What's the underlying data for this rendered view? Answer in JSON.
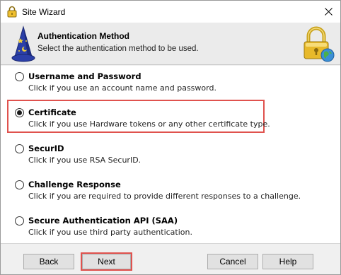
{
  "window": {
    "title": "Site Wizard",
    "close_symbol": "✕"
  },
  "header": {
    "title": "Authentication Method",
    "subtitle": "Select the authentication method to be used."
  },
  "options": [
    {
      "label": "Username and Password",
      "description": "Click if you use an account name and password.",
      "selected": false
    },
    {
      "label": "Certificate",
      "description": "Click if you use Hardware tokens or any other certificate type.",
      "selected": true
    },
    {
      "label": "SecurID",
      "description": "Click if you use RSA SecurID.",
      "selected": false
    },
    {
      "label": "Challenge Response",
      "description": "Click if you are required to provide different responses to a challenge.",
      "selected": false
    },
    {
      "label": "Secure Authentication API (SAA)",
      "description": "Click if you use third party authentication.",
      "selected": false
    }
  ],
  "buttons": {
    "back": "Back",
    "next": "Next",
    "cancel": "Cancel",
    "help": "Help"
  },
  "icons": {
    "title": "padlock-icon",
    "wizard": "wizard-hat-icon",
    "header": "lock-globe-icon",
    "close": "close-icon"
  },
  "colors": {
    "highlight": "#e0524e",
    "header_bg": "#ebebeb",
    "lock_gold": "#e8b92a"
  }
}
